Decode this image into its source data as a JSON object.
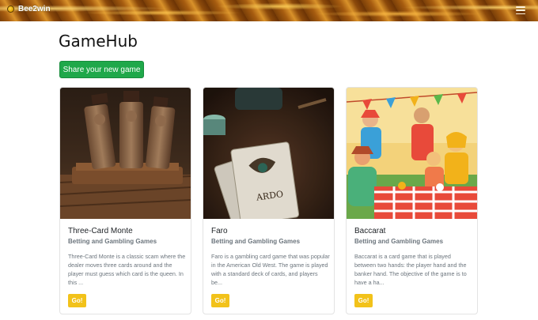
{
  "navbar": {
    "brand": "Bee2win",
    "logo_icon": "bee-coin-icon",
    "menu_icon": "hamburger-menu-icon"
  },
  "header": {
    "title": "GameHub",
    "share_label": "Share your new game"
  },
  "colors": {
    "share_button": "#1fa84a",
    "go_button": "#f2c21a"
  },
  "cards": [
    {
      "title": "Three-Card Monte",
      "category": "Betting and Gambling Games",
      "description": "Three-Card Monte is a classic scam where the dealer moves three cards around and the player must guess which card is the queen. In this ...",
      "button": "Go!"
    },
    {
      "title": "Faro",
      "category": "Betting and Gambling Games",
      "description": "Faro is a gambling card game that was popular in the American Old West. The game is played with a standard deck of cards, and players be...",
      "button": "Go!"
    },
    {
      "title": "Baccarat",
      "category": "Betting and Gambling Games",
      "description": "Baccarat is a card game that is played between two hands: the player hand and the banker hand. The objective of the game is to have a ha...",
      "button": "Go!"
    }
  ]
}
